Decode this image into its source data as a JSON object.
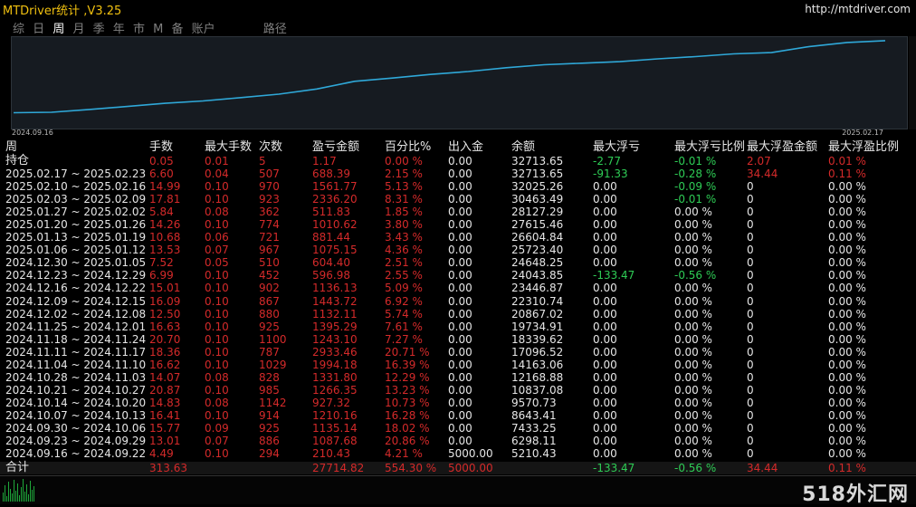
{
  "window": {
    "title": "MTDriver统计 ,V3.25",
    "url": "http://mtdriver.com"
  },
  "tabs": [
    "综",
    "日",
    "周",
    "月",
    "季",
    "年",
    "市",
    "M",
    "备",
    "账户"
  ],
  "active_tab": "周",
  "path_label": "路径",
  "chart": {
    "start_date": "2024.09.16",
    "end_date": "2025.02.17",
    "line_color": "#2fa8d8",
    "equity_values": [
      5210.43,
      6298.11,
      7433.25,
      8643.41,
      9570.73,
      10837.08,
      12168.88,
      14163.06,
      17096.52,
      18339.62,
      19734.91,
      20867.02,
      22310.74,
      23446.87,
      24043.85,
      24648.25,
      25723.4,
      26604.84,
      27615.46,
      28127.29,
      30463.49,
      32025.26,
      32713.65
    ]
  },
  "table": {
    "headers": [
      "周",
      "手数",
      "最大手数",
      "次数",
      "盈亏金额",
      "百分比%",
      "出入金",
      "余额",
      "最大浮亏",
      "最大浮亏比例",
      "最大浮盈金额",
      "最大浮盈比例"
    ],
    "holding": {
      "label": "持仓",
      "lots": "0.05",
      "max_lots": "0.01",
      "count": "5",
      "pl": "1.17",
      "pct": "0.00 %",
      "io": "0.00",
      "balance": "32713.65",
      "max_float_loss": "-2.77",
      "max_float_loss_pct": "-0.01 %",
      "max_float_profit": "2.07",
      "max_float_profit_pct": "0.01 %"
    },
    "rows": [
      {
        "period": "2025.02.17 ~ 2025.02.23",
        "lots": "6.60",
        "max_lots": "0.04",
        "count": "507",
        "pl": "688.39",
        "pct": "2.15 %",
        "io": "0.00",
        "balance": "32713.65",
        "mfl": "-91.33",
        "mflp": "-0.28 %",
        "mfp": "34.44",
        "mfpp": "0.11 %"
      },
      {
        "period": "2025.02.10 ~ 2025.02.16",
        "lots": "14.99",
        "max_lots": "0.10",
        "count": "970",
        "pl": "1561.77",
        "pct": "5.13 %",
        "io": "0.00",
        "balance": "32025.26",
        "mfl": "0.00",
        "mflp": "-0.09 %",
        "mfp": "0",
        "mfpp": "0.00 %"
      },
      {
        "period": "2025.02.03 ~ 2025.02.09",
        "lots": "17.81",
        "max_lots": "0.10",
        "count": "923",
        "pl": "2336.20",
        "pct": "8.31 %",
        "io": "0.00",
        "balance": "30463.49",
        "mfl": "0.00",
        "mflp": "-0.01 %",
        "mfp": "0",
        "mfpp": "0.00 %"
      },
      {
        "period": "2025.01.27 ~ 2025.02.02",
        "lots": "5.84",
        "max_lots": "0.08",
        "count": "362",
        "pl": "511.83",
        "pct": "1.85 %",
        "io": "0.00",
        "balance": "28127.29",
        "mfl": "0.00",
        "mflp": "0.00 %",
        "mfp": "0",
        "mfpp": "0.00 %"
      },
      {
        "period": "2025.01.20 ~ 2025.01.26",
        "lots": "14.26",
        "max_lots": "0.10",
        "count": "774",
        "pl": "1010.62",
        "pct": "3.80 %",
        "io": "0.00",
        "balance": "27615.46",
        "mfl": "0.00",
        "mflp": "0.00 %",
        "mfp": "0",
        "mfpp": "0.00 %"
      },
      {
        "period": "2025.01.13 ~ 2025.01.19",
        "lots": "10.68",
        "max_lots": "0.06",
        "count": "721",
        "pl": "881.44",
        "pct": "3.43 %",
        "io": "0.00",
        "balance": "26604.84",
        "mfl": "0.00",
        "mflp": "0.00 %",
        "mfp": "0",
        "mfpp": "0.00 %"
      },
      {
        "period": "2025.01.06 ~ 2025.01.12",
        "lots": "13.53",
        "max_lots": "0.07",
        "count": "967",
        "pl": "1075.15",
        "pct": "4.36 %",
        "io": "0.00",
        "balance": "25723.40",
        "mfl": "0.00",
        "mflp": "0.00 %",
        "mfp": "0",
        "mfpp": "0.00 %"
      },
      {
        "period": "2024.12.30 ~ 2025.01.05",
        "lots": "7.52",
        "max_lots": "0.05",
        "count": "510",
        "pl": "604.40",
        "pct": "2.51 %",
        "io": "0.00",
        "balance": "24648.25",
        "mfl": "0.00",
        "mflp": "0.00 %",
        "mfp": "0",
        "mfpp": "0.00 %"
      },
      {
        "period": "2024.12.23 ~ 2024.12.29",
        "lots": "6.99",
        "max_lots": "0.10",
        "count": "452",
        "pl": "596.98",
        "pct": "2.55 %",
        "io": "0.00",
        "balance": "24043.85",
        "mfl": "-133.47",
        "mflp": "-0.56 %",
        "mfp": "0",
        "mfpp": "0.00 %"
      },
      {
        "period": "2024.12.16 ~ 2024.12.22",
        "lots": "15.01",
        "max_lots": "0.10",
        "count": "902",
        "pl": "1136.13",
        "pct": "5.09 %",
        "io": "0.00",
        "balance": "23446.87",
        "mfl": "0.00",
        "mflp": "0.00 %",
        "mfp": "0",
        "mfpp": "0.00 %"
      },
      {
        "period": "2024.12.09 ~ 2024.12.15",
        "lots": "16.09",
        "max_lots": "0.10",
        "count": "867",
        "pl": "1443.72",
        "pct": "6.92 %",
        "io": "0.00",
        "balance": "22310.74",
        "mfl": "0.00",
        "mflp": "0.00 %",
        "mfp": "0",
        "mfpp": "0.00 %"
      },
      {
        "period": "2024.12.02 ~ 2024.12.08",
        "lots": "12.50",
        "max_lots": "0.10",
        "count": "880",
        "pl": "1132.11",
        "pct": "5.74 %",
        "io": "0.00",
        "balance": "20867.02",
        "mfl": "0.00",
        "mflp": "0.00 %",
        "mfp": "0",
        "mfpp": "0.00 %"
      },
      {
        "period": "2024.11.25 ~ 2024.12.01",
        "lots": "16.63",
        "max_lots": "0.10",
        "count": "925",
        "pl": "1395.29",
        "pct": "7.61 %",
        "io": "0.00",
        "balance": "19734.91",
        "mfl": "0.00",
        "mflp": "0.00 %",
        "mfp": "0",
        "mfpp": "0.00 %"
      },
      {
        "period": "2024.11.18 ~ 2024.11.24",
        "lots": "20.70",
        "max_lots": "0.10",
        "count": "1100",
        "pl": "1243.10",
        "pct": "7.27 %",
        "io": "0.00",
        "balance": "18339.62",
        "mfl": "0.00",
        "mflp": "0.00 %",
        "mfp": "0",
        "mfpp": "0.00 %"
      },
      {
        "period": "2024.11.11 ~ 2024.11.17",
        "lots": "18.36",
        "max_lots": "0.10",
        "count": "787",
        "pl": "2933.46",
        "pct": "20.71 %",
        "io": "0.00",
        "balance": "17096.52",
        "mfl": "0.00",
        "mflp": "0.00 %",
        "mfp": "0",
        "mfpp": "0.00 %"
      },
      {
        "period": "2024.11.04 ~ 2024.11.10",
        "lots": "16.62",
        "max_lots": "0.10",
        "count": "1029",
        "pl": "1994.18",
        "pct": "16.39 %",
        "io": "0.00",
        "balance": "14163.06",
        "mfl": "0.00",
        "mflp": "0.00 %",
        "mfp": "0",
        "mfpp": "0.00 %"
      },
      {
        "period": "2024.10.28 ~ 2024.11.03",
        "lots": "14.07",
        "max_lots": "0.08",
        "count": "828",
        "pl": "1331.80",
        "pct": "12.29 %",
        "io": "0.00",
        "balance": "12168.88",
        "mfl": "0.00",
        "mflp": "0.00 %",
        "mfp": "0",
        "mfpp": "0.00 %"
      },
      {
        "period": "2024.10.21 ~ 2024.10.27",
        "lots": "20.87",
        "max_lots": "0.10",
        "count": "985",
        "pl": "1266.35",
        "pct": "13.23 %",
        "io": "0.00",
        "balance": "10837.08",
        "mfl": "0.00",
        "mflp": "0.00 %",
        "mfp": "0",
        "mfpp": "0.00 %"
      },
      {
        "period": "2024.10.14 ~ 2024.10.20",
        "lots": "14.83",
        "max_lots": "0.08",
        "count": "1142",
        "pl": "927.32",
        "pct": "10.73 %",
        "io": "0.00",
        "balance": "9570.73",
        "mfl": "0.00",
        "mflp": "0.00 %",
        "mfp": "0",
        "mfpp": "0.00 %"
      },
      {
        "period": "2024.10.07 ~ 2024.10.13",
        "lots": "16.41",
        "max_lots": "0.10",
        "count": "914",
        "pl": "1210.16",
        "pct": "16.28 %",
        "io": "0.00",
        "balance": "8643.41",
        "mfl": "0.00",
        "mflp": "0.00 %",
        "mfp": "0",
        "mfpp": "0.00 %"
      },
      {
        "period": "2024.09.30 ~ 2024.10.06",
        "lots": "15.77",
        "max_lots": "0.09",
        "count": "925",
        "pl": "1135.14",
        "pct": "18.02 %",
        "io": "0.00",
        "balance": "7433.25",
        "mfl": "0.00",
        "mflp": "0.00 %",
        "mfp": "0",
        "mfpp": "0.00 %"
      },
      {
        "period": "2024.09.23 ~ 2024.09.29",
        "lots": "13.01",
        "max_lots": "0.07",
        "count": "886",
        "pl": "1087.68",
        "pct": "20.86 %",
        "io": "0.00",
        "balance": "6298.11",
        "mfl": "0.00",
        "mflp": "0.00 %",
        "mfp": "0",
        "mfpp": "0.00 %"
      },
      {
        "period": "2024.09.16 ~ 2024.09.22",
        "lots": "4.49",
        "max_lots": "0.10",
        "count": "294",
        "pl": "210.43",
        "pct": "4.21 %",
        "io": "5000.00",
        "balance": "5210.43",
        "mfl": "0.00",
        "mflp": "0.00 %",
        "mfp": "0",
        "mfpp": "0.00 %"
      }
    ],
    "total": {
      "label": "合计",
      "lots": "313.63",
      "pl": "27714.82",
      "pct": "554.30 %",
      "io": "5000.00",
      "mfl": "-133.47",
      "mflp": "-0.56 %",
      "mfp": "34.44",
      "mfpp": "0.11 %"
    }
  },
  "watermark": "518外汇网",
  "colors": {
    "positive": "#d42a2a",
    "negative": "#2ecc55",
    "title": "#f0c010",
    "chart_bg": "#161b21",
    "mini_chart": "#1ea83a"
  }
}
